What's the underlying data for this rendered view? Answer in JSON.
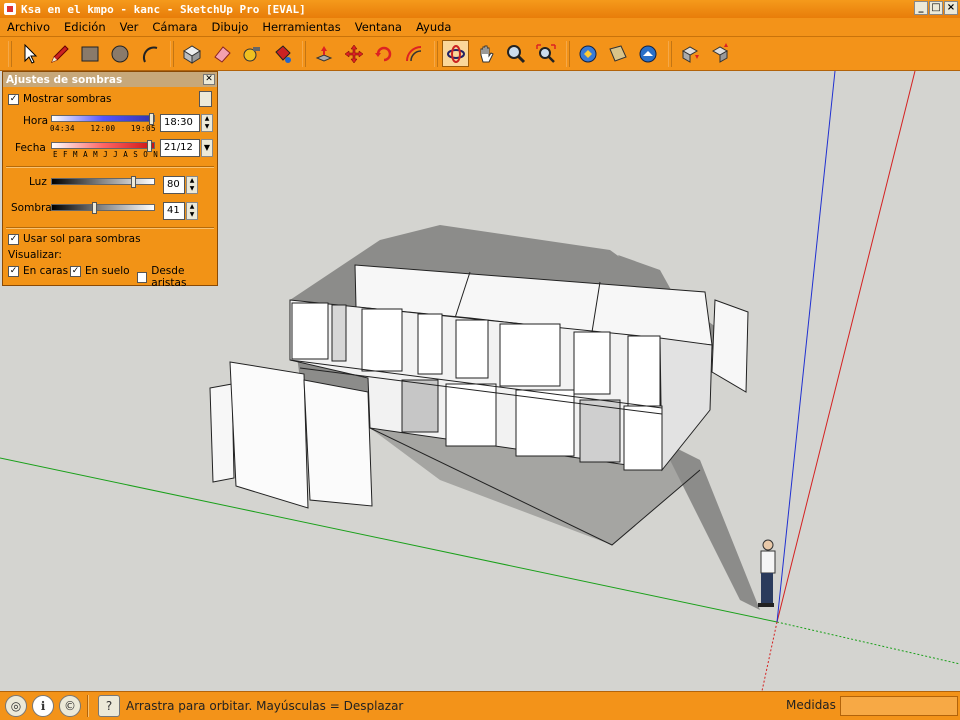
{
  "window": {
    "title": "Ksa en el kmpo - kanc - SketchUp Pro [EVAL]",
    "buttons": [
      "_",
      "□",
      "×"
    ]
  },
  "menu": [
    "Archivo",
    "Edición",
    "Ver",
    "Cámara",
    "Dibujo",
    "Herramientas",
    "Ventana",
    "Ayuda"
  ],
  "toolbar": {
    "tools": [
      "select-icon",
      "pencil-icon",
      "rectangle-icon",
      "circle-icon",
      "arc-icon",
      "make-component-icon",
      "eraser-icon",
      "tape-measure-icon",
      "paint-bucket-icon",
      "push-pull-icon",
      "move-icon",
      "rotate-icon",
      "offset-icon",
      "orbit-icon",
      "pan-icon",
      "zoom-icon",
      "zoom-extents-icon",
      "get-models-icon",
      "share-model-icon",
      "google-earth-icon",
      "import-icon",
      "export-icon"
    ],
    "active_tool": "orbit-icon"
  },
  "shadow_panel": {
    "title": "Ajustes de sombras",
    "show_shadows_label": "Mostrar sombras",
    "show_shadows": true,
    "time_label": "Hora",
    "time_ticks": [
      "04:34",
      "12:00",
      "19:05"
    ],
    "time_value": "18:30",
    "date_label": "Fecha",
    "date_ticks": "E F M A M J J A S O N D",
    "date_value": "21/12",
    "light_label": "Luz",
    "light_value": "80",
    "dark_label": "Sombra",
    "dark_value": "41",
    "use_sun_label": "Usar sol para sombras",
    "use_sun": true,
    "display_label": "Visualizar:",
    "on_faces_label": "En caras",
    "on_faces": true,
    "on_ground_label": "En suelo",
    "on_ground": true,
    "from_edges_label": "Desde aristas",
    "from_edges": false
  },
  "status": {
    "hint": "Arrastra para orbitar. Mayúsculas = Desplazar",
    "measure_label": "Medidas",
    "measure_value": ""
  },
  "colors": {
    "chrome": "#f39319",
    "viewport": "#d4d4d0",
    "axis_red": "#d42020",
    "axis_green": "#1aa01a",
    "axis_blue": "#2030d0"
  }
}
